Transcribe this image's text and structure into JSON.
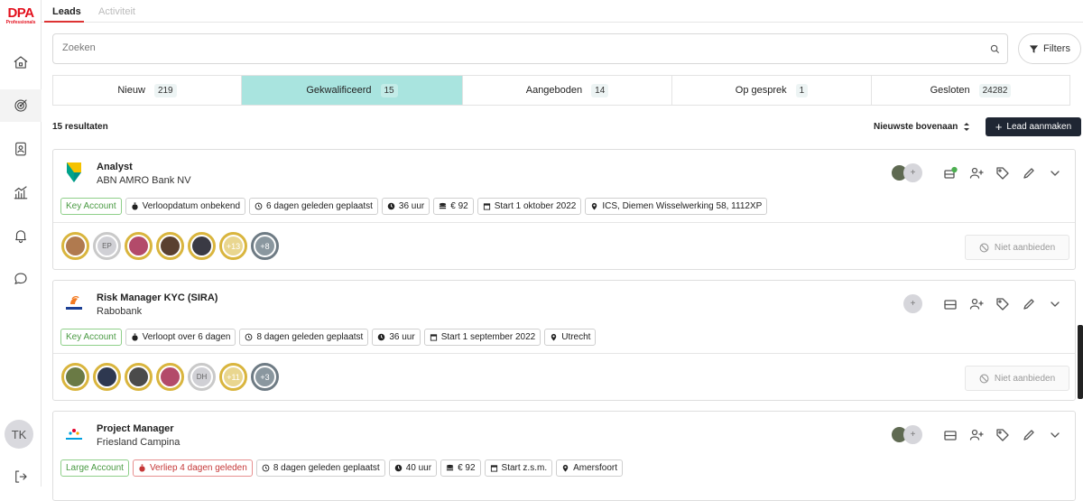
{
  "brand": {
    "logo_text": "DPA",
    "logo_sub": "Professionals",
    "color": "#e3101d"
  },
  "top_tabs": [
    "Leads",
    "Activiteit"
  ],
  "sidebar": {
    "icons": [
      "home-icon",
      "target-icon",
      "contacts-icon",
      "stats-icon",
      "bell-icon",
      "chat-icon"
    ],
    "user_initials": "TK",
    "logout_icon": "logout-icon"
  },
  "search": {
    "placeholder": "Zoeken"
  },
  "filters_label": "Filters",
  "status_tabs": [
    {
      "label": "Nieuw",
      "count": "219"
    },
    {
      "label": "Gekwalificeerd",
      "count": "15"
    },
    {
      "label": "Aangeboden",
      "count": "14"
    },
    {
      "label": "Op gesprek",
      "count": "1"
    },
    {
      "label": "Gesloten",
      "count": "24282"
    }
  ],
  "active_status_color": "#a9e4df",
  "results_label": "15 resultaten",
  "sort_label": "Nieuwste bovenaan",
  "new_lead_label": "Lead aanmaken",
  "not_offer_label": "Niet aanbieden",
  "leads": [
    {
      "title": "Analyst",
      "company": "ABN AMRO Bank NV",
      "account_type": "Key Account",
      "expiry": "Verloopdatum onbekend",
      "posted": "6 dagen geleden geplaatst",
      "hours": "36 uur",
      "rate": "€ 92",
      "start": "Start 1 oktober 2022",
      "location": "ICS, Diemen Wisselwerking 58, 1112XP",
      "candidates_more": "+13",
      "candidates_rest": "+8",
      "candidate_initials": "EP"
    },
    {
      "title": "Risk Manager KYC (SIRA)",
      "company": "Rabobank",
      "account_type": "Key Account",
      "expiry": "Verloopt over 6 dagen",
      "posted": "8 dagen geleden geplaatst",
      "hours": "36 uur",
      "start": "Start 1 september 2022",
      "location": "Utrecht",
      "candidates_more": "+11",
      "candidates_rest": "+3",
      "candidate_initials": "DH"
    },
    {
      "title": "Project Manager",
      "company": "Friesland Campina",
      "account_type": "Large Account",
      "expiry": "Verliep 4 dagen geleden",
      "posted": "8 dagen geleden geplaatst",
      "hours": "40 uur",
      "rate": "€ 92",
      "start": "Start z.s.m.",
      "location": "Amersfoort"
    }
  ]
}
